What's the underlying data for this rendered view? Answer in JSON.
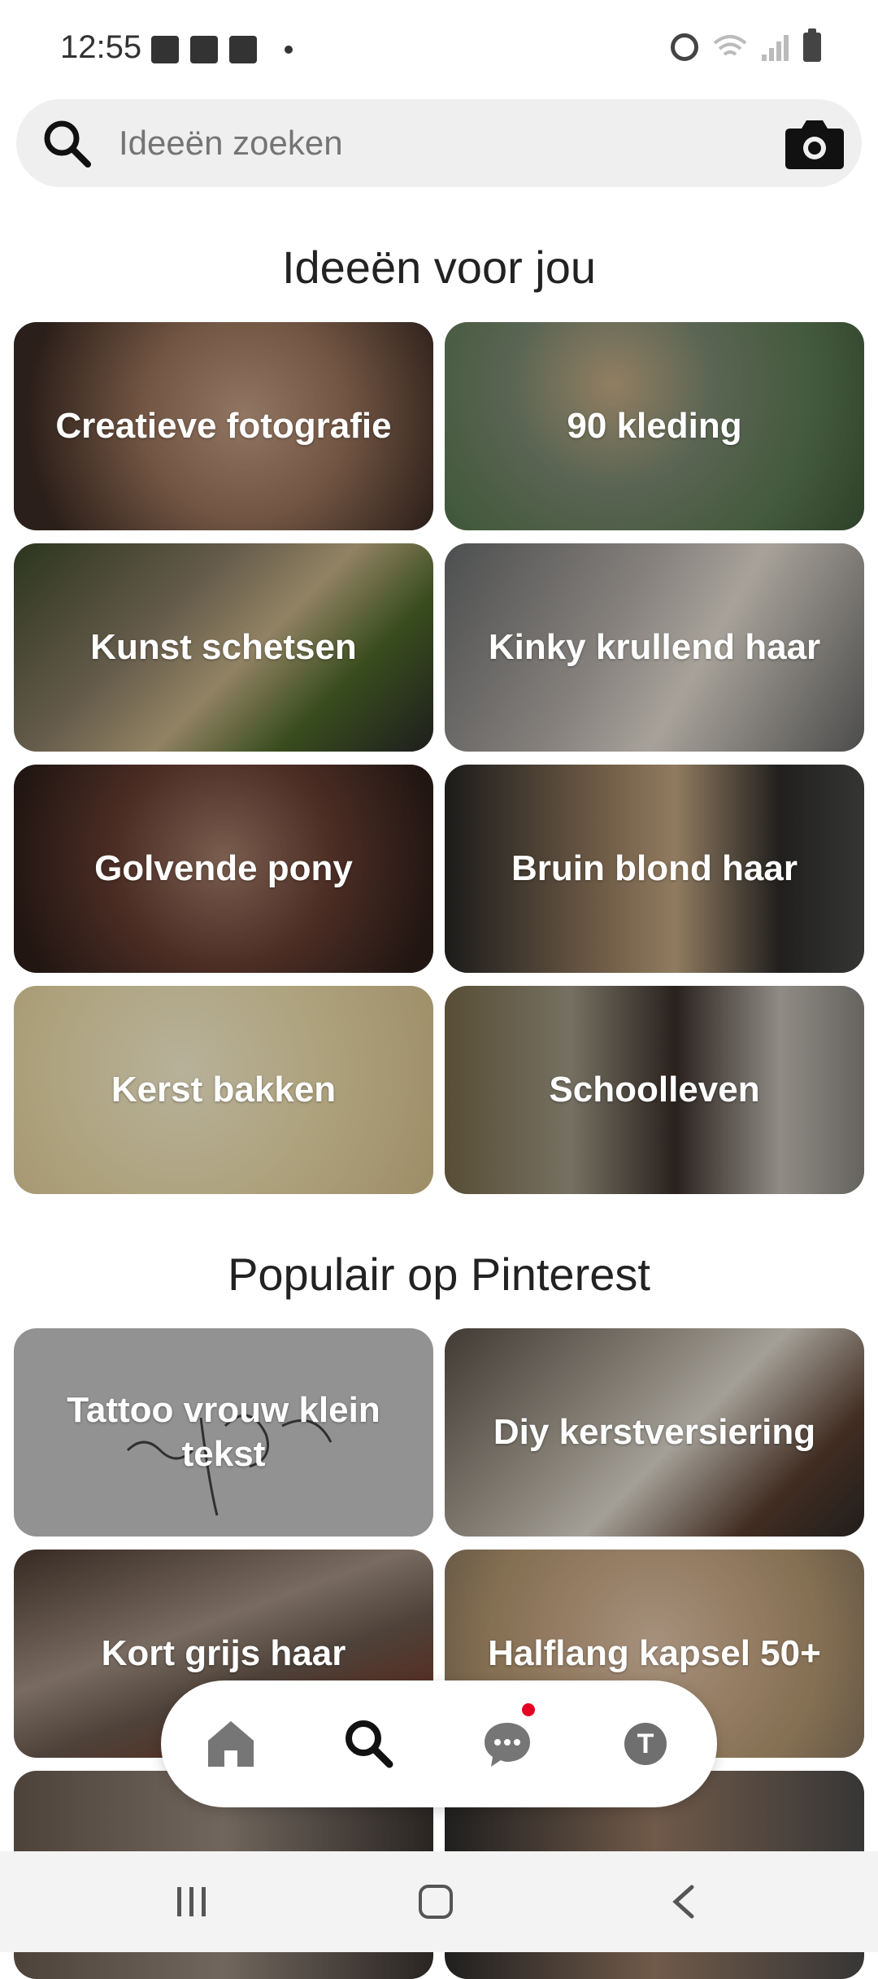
{
  "status_bar": {
    "time": "12:55",
    "left_icons": [
      "image-icon",
      "mail-icon",
      "app-icon",
      "dot-icon"
    ],
    "right_icons": [
      "alarm-icon",
      "wifi-icon",
      "signal-icon",
      "battery-icon"
    ]
  },
  "search": {
    "placeholder": "Ideeën zoeken",
    "icon": "search-icon",
    "camera_icon": "camera-icon"
  },
  "sections": [
    {
      "title": "Ideeën voor jou",
      "tiles": [
        {
          "label": "Creatieve fotografie"
        },
        {
          "label": "90 kleding"
        },
        {
          "label": "Kunst schetsen"
        },
        {
          "label": "Kinky krullend haar"
        },
        {
          "label": "Golvende pony"
        },
        {
          "label": "Bruin blond haar"
        },
        {
          "label": "Kerst bakken"
        },
        {
          "label": "Schoolleven"
        }
      ]
    },
    {
      "title": "Populair op Pinterest",
      "tiles": [
        {
          "label": "Tattoo vrouw klein tekst"
        },
        {
          "label": "Diy kerstversiering"
        },
        {
          "label": "Kort grijs haar"
        },
        {
          "label": "Halflang kapsel 50+"
        },
        {
          "label": ""
        },
        {
          "label": ""
        }
      ]
    }
  ],
  "bottom_nav": {
    "items": [
      "home-icon",
      "search-icon",
      "messages-icon",
      "profile-avatar"
    ],
    "avatar_letter": "T",
    "notification_color": "#e60023"
  },
  "system_nav": [
    "recent-apps-icon",
    "home-icon",
    "back-icon"
  ],
  "colors": {
    "accent": "#e60023",
    "search_bg": "#efefef",
    "nav_icon": "#767676"
  }
}
